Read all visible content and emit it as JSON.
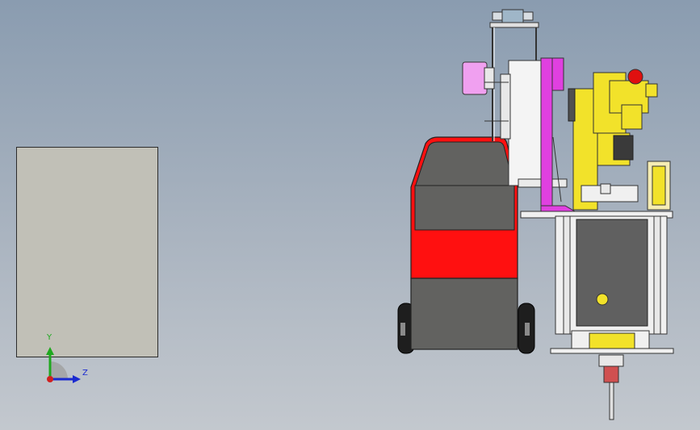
{
  "viewport": {
    "background_top": "#8a9cb0",
    "background_bottom": "#c3c8ce"
  },
  "triad": {
    "y_label": "Y",
    "z_label": "Z",
    "y_color": "#1fa81f",
    "z_color": "#1a2ad0",
    "x_color": "#d02020"
  },
  "model": {
    "cart_body_color": "#ff1010",
    "robot_color": "#f2e22a",
    "rail_color": "#e040e0",
    "panel_color": "#606060"
  }
}
